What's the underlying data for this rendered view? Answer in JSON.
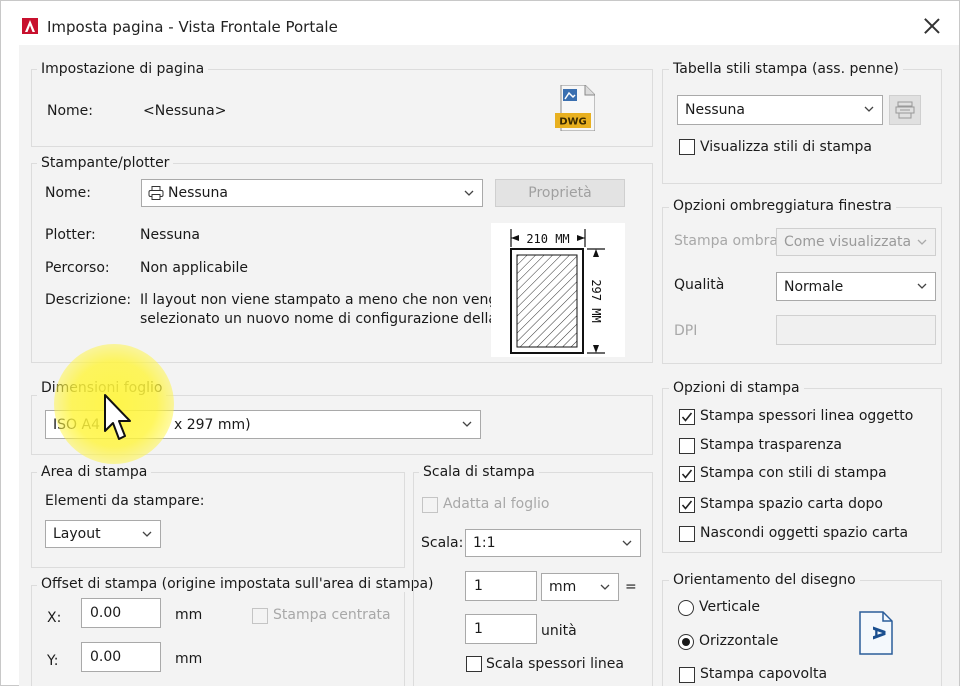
{
  "window": {
    "title": "Imposta pagina - Vista Frontale Portale"
  },
  "page_setup": {
    "group_label": "Impostazione di pagina",
    "name_label": "Nome:",
    "name_value": "<Nessuna>",
    "file_icon_text": "DWG"
  },
  "printer": {
    "group_label": "Stampante/plotter",
    "name_label": "Nome:",
    "name_value": "Nessuna",
    "properties_button": "Proprietà",
    "plotter_label": "Plotter:",
    "plotter_value": "Nessuna",
    "path_label": "Percorso:",
    "path_value": "Non applicabile",
    "description_label": "Descrizione:",
    "description_line1": "Il layout non viene stampato a meno che non venga",
    "description_line2": "selezionato un nuovo nome di configurazione della",
    "preview_width": "210 MM",
    "preview_height": "297 MM"
  },
  "paper_size": {
    "group_label": "Dimensioni foglio",
    "value_left": "ISO A4",
    "value_right": "x 297 mm)"
  },
  "plot_area": {
    "group_label": "Area di stampa",
    "what_label": "Elementi da stampare:",
    "what_value": "Layout"
  },
  "plot_offset": {
    "group_label": "Offset di stampa (origine impostata sull'area di stampa)",
    "x_label": "X:",
    "x_value": "0.00",
    "x_unit": "mm",
    "y_label": "Y:",
    "y_value": "0.00",
    "y_unit": "mm",
    "center_label": "Stampa centrata"
  },
  "plot_scale": {
    "group_label": "Scala di stampa",
    "fit_label": "Adatta al foglio",
    "scale_label": "Scala:",
    "scale_value": "1:1",
    "value1": "1",
    "unit1": "mm",
    "equals": "=",
    "value2": "1",
    "unit2": "unità",
    "lineweights_label": "Scala spessori linea"
  },
  "plot_style_table": {
    "group_label": "Tabella stili stampa (ass. penne)",
    "value": "Nessuna",
    "display_label": "Visualizza stili di stampa"
  },
  "shaded_viewport": {
    "group_label": "Opzioni ombreggiatura finestra",
    "shade_label": "Stampa ombra",
    "shade_value": "Come visualizzata",
    "quality_label": "Qualità",
    "quality_value": "Normale",
    "dpi_label": "DPI"
  },
  "plot_options": {
    "group_label": "Opzioni di stampa",
    "items": [
      {
        "label": "Stampa spessori linea oggetto",
        "checked": true
      },
      {
        "label": "Stampa trasparenza",
        "checked": false
      },
      {
        "label": "Stampa con stili di stampa",
        "checked": true
      },
      {
        "label": "Stampa spazio carta dopo",
        "checked": true
      },
      {
        "label": "Nascondi oggetti spazio carta",
        "checked": false
      }
    ]
  },
  "orientation": {
    "group_label": "Orientamento del disegno",
    "portrait_label": "Verticale",
    "landscape_label": "Orizzontale",
    "upside_down_label": "Stampa capovolta",
    "selected": "Orizzontale",
    "preview_glyph": "A"
  },
  "colors": {
    "dialog_bg": "#f3f3f3",
    "highlight": "#fff53c",
    "dwg_icon": "#e8b020"
  }
}
